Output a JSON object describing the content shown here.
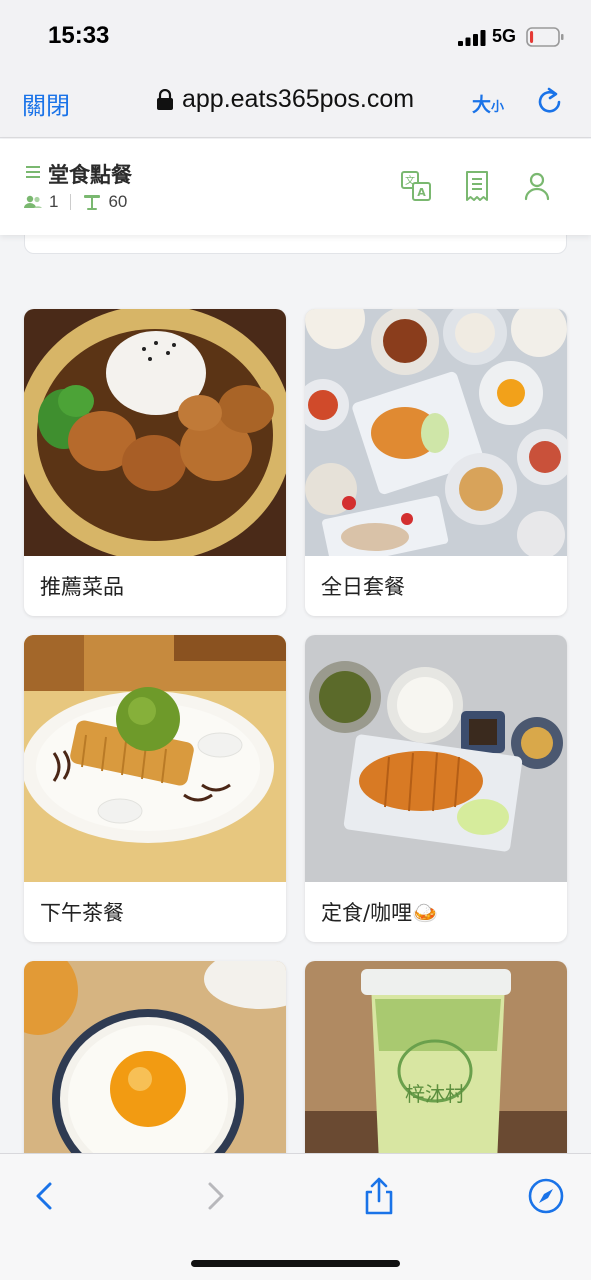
{
  "status_bar": {
    "time": "15:33",
    "network": "5G",
    "battery_level": 0.12,
    "battery_color": "#e53935"
  },
  "browser": {
    "close_label": "關閉",
    "url": "app.eats365pos.com",
    "text_size_big": "大",
    "text_size_small": "小",
    "accent_color": "#1a73e8"
  },
  "header": {
    "title": "堂食點餐",
    "guests": "1",
    "table": "60",
    "accent_color": "#7ab870",
    "icons": [
      "translate-icon",
      "receipt-icon",
      "user-icon"
    ]
  },
  "categories": [
    {
      "label": "推薦菜品",
      "image": "karaage-rice-plate"
    },
    {
      "label": "全日套餐",
      "image": "set-meal-spread"
    },
    {
      "label": "下午茶餐",
      "image": "matcha-waffle"
    },
    {
      "label": "定食/咖哩🍛",
      "image": "tonkatsu-set"
    },
    {
      "label": "",
      "image": "egg-rice-bowl"
    },
    {
      "label": "",
      "image": "iced-drink"
    }
  ],
  "toolbar": {
    "icons": [
      "back-icon",
      "forward-icon",
      "share-icon",
      "compass-icon"
    ]
  }
}
